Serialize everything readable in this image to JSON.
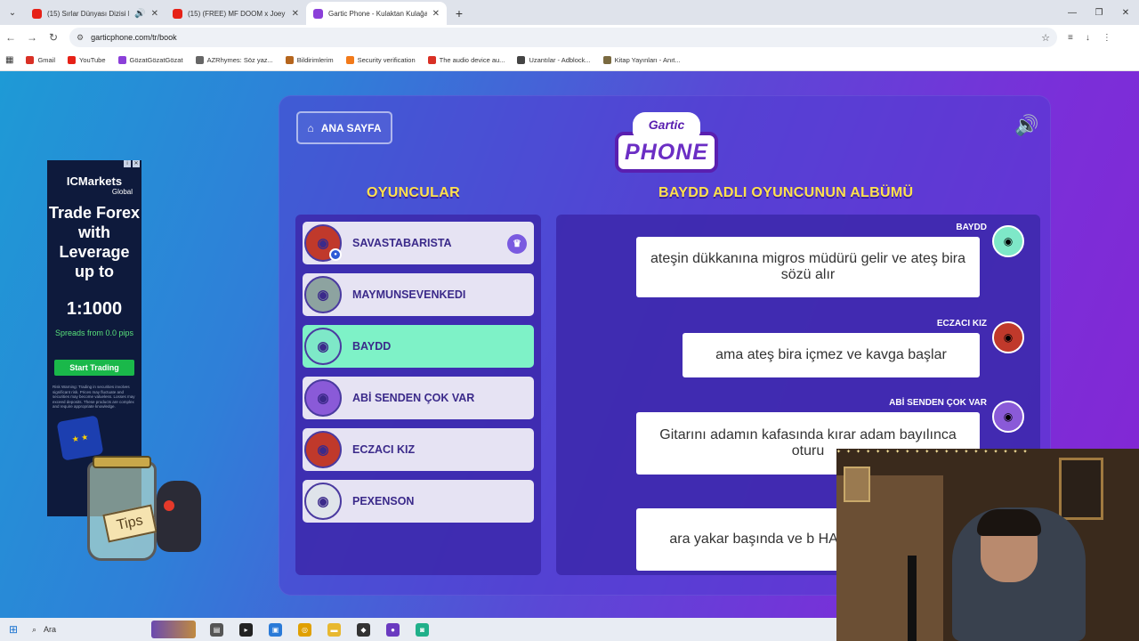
{
  "browser": {
    "tabs": [
      {
        "title": "(15) Sırlar Dünyası Dizisi Fo",
        "color": "#e62117"
      },
      {
        "title": "(15) (FREE) MF DOOM x Joey B",
        "color": "#e62117"
      },
      {
        "title": "Gartic Phone - Kulaktan Kulağa",
        "color": "#8b3fd9"
      }
    ],
    "url": "garticphone.com/tr/book",
    "bookmarks": [
      {
        "label": "Gmail",
        "color": "#d93025"
      },
      {
        "label": "YouTube",
        "color": "#e62117"
      },
      {
        "label": "GözatGözatGözat",
        "color": "#8b3fd9"
      },
      {
        "label": "AZRhymes: Söz yaz...",
        "color": "#666666"
      },
      {
        "label": "Bildirimlerim",
        "color": "#b5651d"
      },
      {
        "label": "Security verification",
        "color": "#f27a1a"
      },
      {
        "label": "The audio device au...",
        "color": "#d93025"
      },
      {
        "label": "Uzantılar - Adblock...",
        "color": "#444444"
      },
      {
        "label": "Kitap Yayınları - Anıt...",
        "color": "#7a6a40"
      }
    ]
  },
  "game": {
    "home_button": "ANA SAYFA",
    "logo_top": "Gartic",
    "logo_bottom": "PHONE",
    "players_title": "OYUNCULAR",
    "album_title": "BAYDD ADLI OYUNCUNUN ALBÜMÜ",
    "players": [
      {
        "name": "SAVASTABARISTA",
        "host": true,
        "selected": false,
        "avatar_color": "#c0392b"
      },
      {
        "name": "MAYMUNSEVENKEDI",
        "host": false,
        "selected": false,
        "avatar_color": "#8da3a0"
      },
      {
        "name": "BAYDD",
        "host": false,
        "selected": true,
        "avatar_color": "#7ee8c8"
      },
      {
        "name": "ABİ SENDEN ÇOK VAR",
        "host": false,
        "selected": false,
        "avatar_color": "#8a5ad8"
      },
      {
        "name": "ECZACI KIZ",
        "host": false,
        "selected": false,
        "avatar_color": "#c0392b"
      },
      {
        "name": "PEXENSON",
        "host": false,
        "selected": false,
        "avatar_color": "#dfe4ea"
      }
    ],
    "messages": [
      {
        "author": "BAYDD",
        "text": "ateşin dükkanına migros müdürü gelir ve ateş bira sözü alır",
        "avatar_color": "#7ee8c8"
      },
      {
        "author": "ECZACI KIZ",
        "text": "ama ateş bira içmez ve kavga başlar",
        "avatar_color": "#c0392b"
      },
      {
        "author": "ABİ SENDEN ÇOK VAR",
        "text": "Gitarını adamın kafasında kırar adam bayılınca oturu",
        "avatar_color": "#8a5ad8"
      },
      {
        "author": "",
        "text": "ara yakar başında ve b HAYKIR EJDERYAL",
        "avatar_color": ""
      }
    ]
  },
  "ad": {
    "brand": "ICMarkets",
    "brand_sub": "Global",
    "headline": "Trade Forex with Leverage up to",
    "leverage": "1:1000",
    "spreads": "Spreads from 0.0 pips",
    "cta": "Start Trading",
    "disclaimer": "Risk Warning: Trading in securities involves significant risk. Prices may fluctuate and securities may become valueless. Losses may exceed deposits. These products are complex and require appropriate knowledge."
  },
  "overlay": {
    "tip_label": "Tips"
  },
  "taskbar": {
    "search_placeholder": "Ara"
  }
}
